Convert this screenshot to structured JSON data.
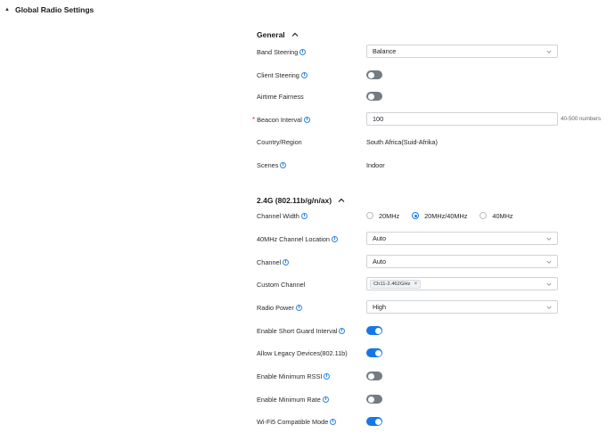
{
  "header": {
    "title": "Global Radio Settings"
  },
  "general": {
    "title": "General",
    "band_steering": {
      "label": "Band Steering",
      "value": "Balance"
    },
    "client_steering": {
      "label": "Client Steering",
      "state": "off"
    },
    "airtime_fairness": {
      "label": "Airtime Fairness",
      "state": "off"
    },
    "beacon_interval": {
      "label": "Beacon Interval",
      "required_mark": "*",
      "value": "100",
      "hint": "40-500 numbers"
    },
    "country_region": {
      "label": "Country/Region",
      "value": "South Africa(Suid-Afrika)"
    },
    "scenes": {
      "label": "Scenes",
      "value": "Indoor"
    }
  },
  "band24": {
    "title": "2.4G (802.11b/g/n/ax)",
    "channel_width": {
      "label": "Channel Width",
      "options": [
        "20MHz",
        "20MHz/40MHz",
        "40MHz"
      ],
      "selected": "20MHz/40MHz"
    },
    "channel_location": {
      "label": "40MHz Channel Location",
      "value": "Auto"
    },
    "channel": {
      "label": "Channel",
      "value": "Auto"
    },
    "custom_channel": {
      "label": "Custom Channel",
      "tag": "Ch11-2.462GHz",
      "tag_remove": "×"
    },
    "radio_power": {
      "label": "Radio Power",
      "value": "High"
    },
    "short_guard": {
      "label": "Enable Short Guard Interval",
      "state": "on"
    },
    "legacy_devices": {
      "label": "Allow Legacy Devices(802.11b)",
      "state": "on"
    },
    "min_rssi": {
      "label": "Enable Minimum RSSI",
      "state": "off"
    },
    "min_rate": {
      "label": "Enable Minimum Rate",
      "state": "off"
    },
    "wifi5_compat": {
      "label": "Wi-Fi5 Compatible Mode",
      "state": "on"
    }
  },
  "colors": {
    "accent": "#1677e6",
    "toggle_off": "#737c85",
    "required": "#e0302a",
    "info": "#2e86de"
  }
}
